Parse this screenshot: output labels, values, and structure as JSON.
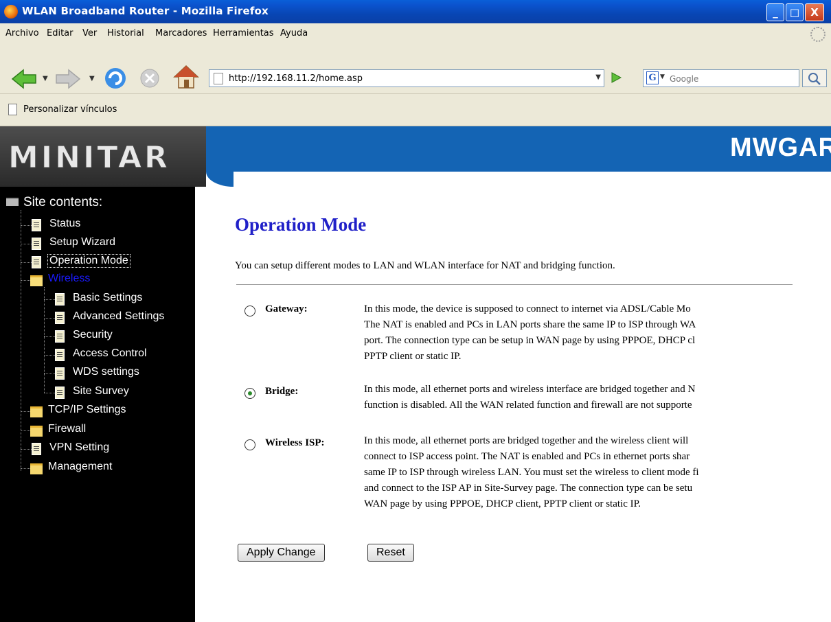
{
  "window": {
    "title": "WLAN Broadband Router - Mozilla Firefox",
    "minimize": "_",
    "maximize": "□",
    "close": "X"
  },
  "menu": [
    "Archivo",
    "Editar",
    "Ver",
    "Historial",
    "Marcadores",
    "Herramientas",
    "Ayuda"
  ],
  "toolbar": {
    "url": "http://192.168.11.2/home.asp",
    "search_placeholder": "Google"
  },
  "bookmarks": {
    "item": "Personalizar vínculos"
  },
  "banner": {
    "logo": "MINITAR",
    "brand": "MWGAR"
  },
  "sidebar": {
    "heading": "Site contents:",
    "items": [
      {
        "label": "Status",
        "icon": "doc-icon"
      },
      {
        "label": "Setup Wizard",
        "icon": "doc-icon"
      },
      {
        "label": "Operation Mode",
        "icon": "doc-icon"
      },
      {
        "label": "Wireless",
        "icon": "folder-open-icon"
      },
      {
        "label": "Basic Settings",
        "icon": "doc-icon"
      },
      {
        "label": "Advanced Settings",
        "icon": "doc-icon"
      },
      {
        "label": "Security",
        "icon": "doc-icon"
      },
      {
        "label": "Access Control",
        "icon": "doc-icon"
      },
      {
        "label": "WDS settings",
        "icon": "doc-icon"
      },
      {
        "label": "Site Survey",
        "icon": "doc-icon"
      },
      {
        "label": "TCP/IP Settings",
        "icon": "folder-icon"
      },
      {
        "label": "Firewall",
        "icon": "folder-icon"
      },
      {
        "label": "VPN Setting",
        "icon": "doc-icon"
      },
      {
        "label": "Management",
        "icon": "folder-icon"
      }
    ]
  },
  "main": {
    "title": "Operation Mode",
    "intro": "You can setup different modes to LAN and WLAN interface for NAT and bridging function.",
    "modes": [
      {
        "label": "Gateway:",
        "selected": false,
        "lines": [
          "In this mode, the device is supposed to connect to internet via ADSL/Cable Mo",
          "The NAT is enabled and PCs in LAN ports share the same IP to ISP through WA",
          "port. The connection type can be setup in WAN page by using PPPOE, DHCP cl",
          "PPTP client or static IP."
        ]
      },
      {
        "label": "Bridge:",
        "selected": true,
        "lines": [
          "In this mode, all ethernet ports and wireless interface are bridged together and N",
          "function is disabled. All the WAN related function and firewall are not supporte"
        ]
      },
      {
        "label": "Wireless ISP:",
        "selected": false,
        "lines": [
          "In this mode, all ethernet ports are bridged together and the wireless client will",
          "connect to ISP access point. The NAT is enabled and PCs in ethernet ports shar",
          "same IP to ISP through wireless LAN. You must set the wireless to client mode fi",
          "and connect to the ISP AP in Site-Survey page. The connection type can be setu",
          "WAN page by using PPPOE, DHCP client, PPTP client or static IP."
        ]
      }
    ],
    "apply_label": "Apply Change",
    "reset_label": "Reset"
  },
  "colors": {
    "title_bar": "#0a54cf",
    "banner_blue": "#1464b4",
    "heading_blue": "#2020c8",
    "active_link": "#1a1aff"
  }
}
